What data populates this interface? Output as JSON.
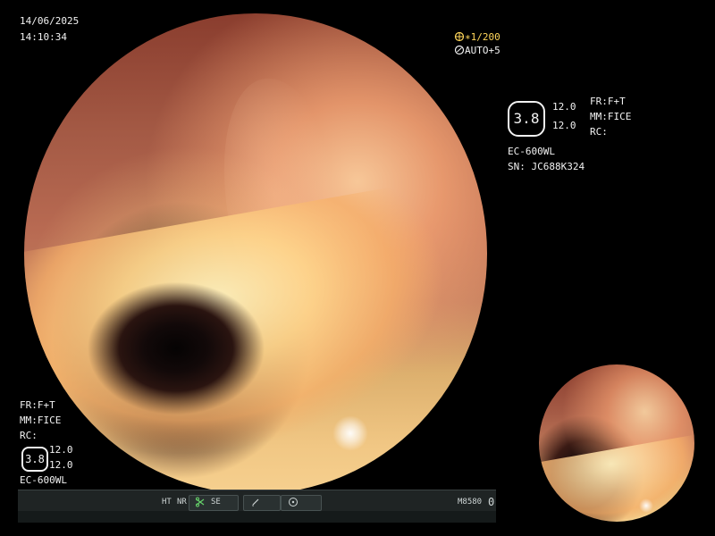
{
  "overlay": {
    "date": "14/06/2025",
    "time": "14:10:34",
    "top_right": {
      "shutter_icon": "shutter-icon",
      "shutter_value": "∗1/200",
      "auto_icon": "auto-icon",
      "auto_value": "AUTO+5"
    },
    "right_panel": {
      "badge_value": "3.8",
      "value_1": "12.0",
      "value_2": "12.0",
      "fr": "FR:F+T",
      "mm": "MM:FICE",
      "rc": "RC:",
      "model": "EC-600WL",
      "serial": "SN: JC688K324"
    },
    "left_bottom_panel": {
      "fr": "FR:F+T",
      "mm": "MM:FICE",
      "rc": "RC:",
      "badge_value": "3.8",
      "value_1": "12.0",
      "value_2": "12.0",
      "model": "EC-600WL"
    }
  },
  "bottom_bar": {
    "ht": "HT",
    "nr": "NR",
    "se": "SE",
    "se_icon": "scissors-icon",
    "edit_icon": "pencil-icon",
    "target_icon": "target-icon",
    "code": "M8580",
    "counter": "0"
  },
  "colors": {
    "overlay_text": "#f2f2f2",
    "shutter_text": "#ffd65a",
    "toolbar_green": "#66d36a",
    "toolbar_bg": "#1f2424"
  }
}
